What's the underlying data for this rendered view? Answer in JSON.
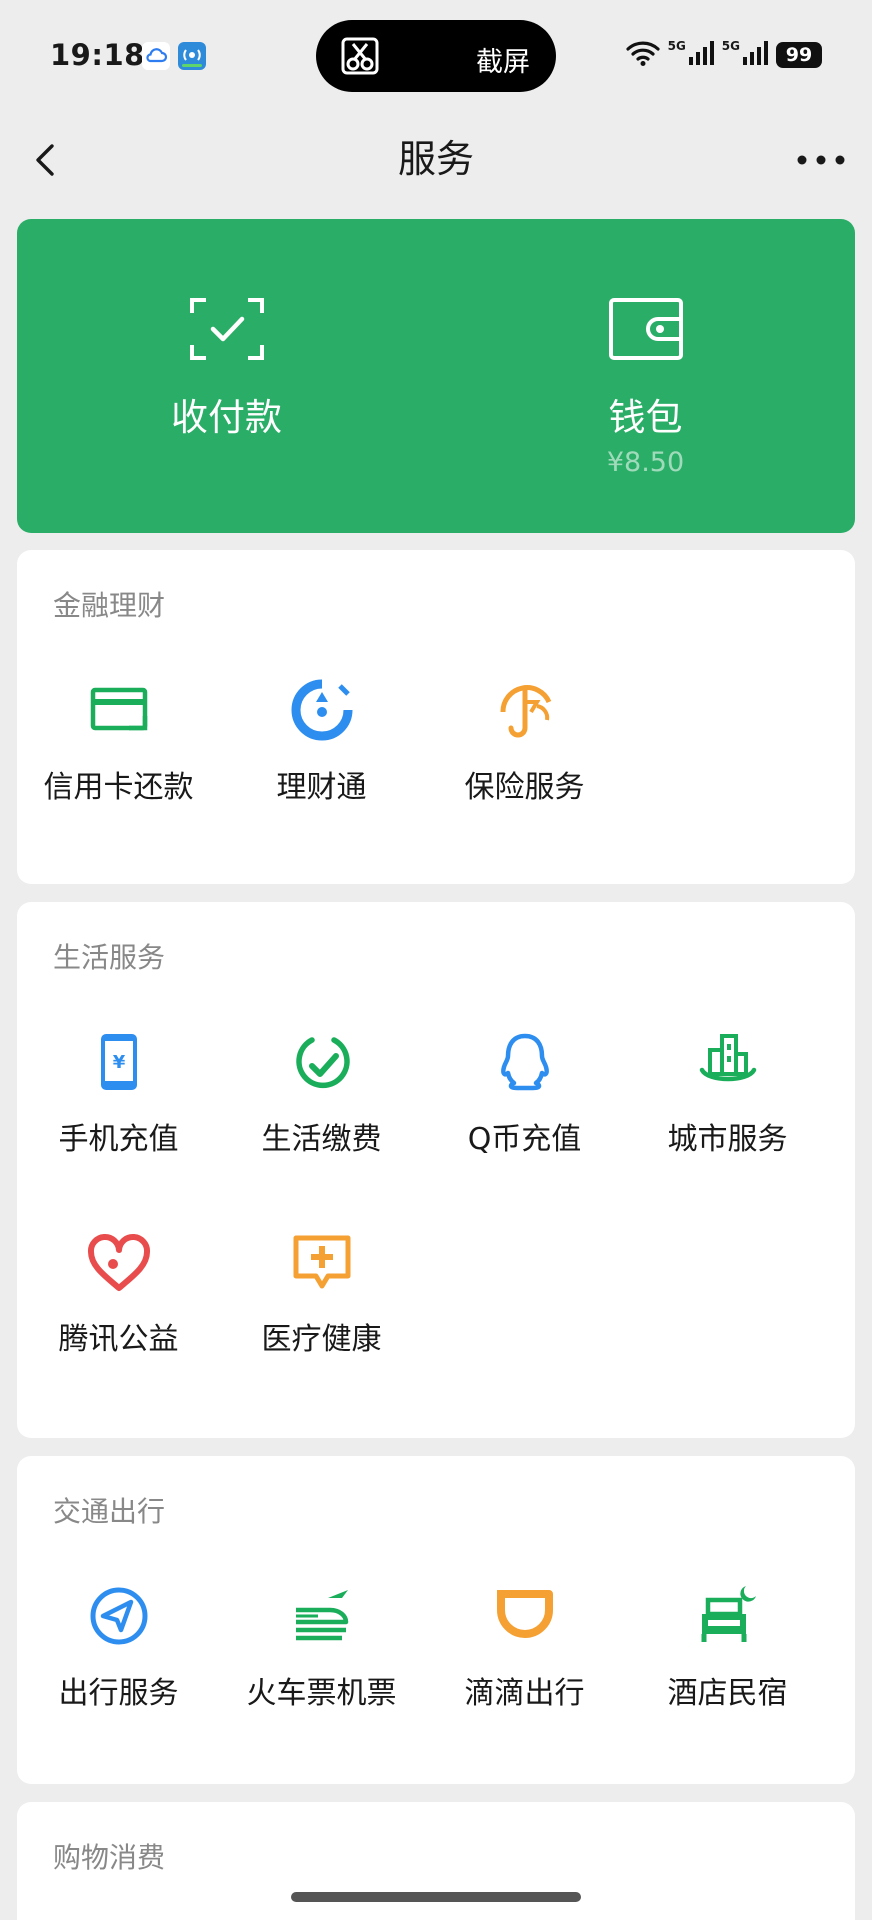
{
  "status_bar": {
    "time": "19:18",
    "island_label": "截屏",
    "network_1": "5G",
    "network_2": "5G",
    "battery": "99",
    "icons": [
      "cloud-icon",
      "signal-app-icon",
      "scissors-icon",
      "wifi-icon",
      "cellular-icon",
      "battery-icon"
    ]
  },
  "nav": {
    "title": "服务",
    "icons": [
      "back-icon",
      "more-icon"
    ]
  },
  "wallet_panel": {
    "background": "#2aae67",
    "pay": {
      "label": "收付款",
      "icon": "scan-check-icon"
    },
    "wallet": {
      "label": "钱包",
      "balance": "¥8.50",
      "icon": "wallet-icon"
    }
  },
  "sections": {
    "finance": {
      "title": "金融理财",
      "items": [
        {
          "label": "信用卡还款",
          "icon": "credit-card-icon",
          "color": "#1aad5a"
        },
        {
          "label": "理财通",
          "icon": "wealth-icon",
          "color": "#2d8ef0"
        },
        {
          "label": "保险服务",
          "icon": "insurance-umbrella-icon",
          "color": "#f5a032"
        }
      ]
    },
    "life": {
      "title": "生活服务",
      "items": [
        {
          "label": "手机充值",
          "icon": "phone-recharge-icon",
          "color": "#2d8ef0"
        },
        {
          "label": "生活缴费",
          "icon": "utility-payment-icon",
          "color": "#1aad5a"
        },
        {
          "label": "Q币充值",
          "icon": "qq-penguin-icon",
          "color": "#2d8ef0"
        },
        {
          "label": "城市服务",
          "icon": "city-building-icon",
          "color": "#1aad5a"
        },
        {
          "label": "腾讯公益",
          "icon": "charity-heart-icon",
          "color": "#e94c4c"
        },
        {
          "label": "医疗健康",
          "icon": "medical-cross-icon",
          "color": "#f5a032"
        }
      ]
    },
    "transport": {
      "title": "交通出行",
      "items": [
        {
          "label": "出行服务",
          "icon": "navigation-arrow-icon",
          "color": "#2d8ef0"
        },
        {
          "label": "火车票机票",
          "icon": "train-plane-icon",
          "color": "#1aad5a"
        },
        {
          "label": "滴滴出行",
          "icon": "didi-icon",
          "color": "#f5a032"
        },
        {
          "label": "酒店民宿",
          "icon": "hotel-bed-icon",
          "color": "#1aad5a"
        }
      ]
    },
    "shopping": {
      "title": "购物消费"
    }
  }
}
